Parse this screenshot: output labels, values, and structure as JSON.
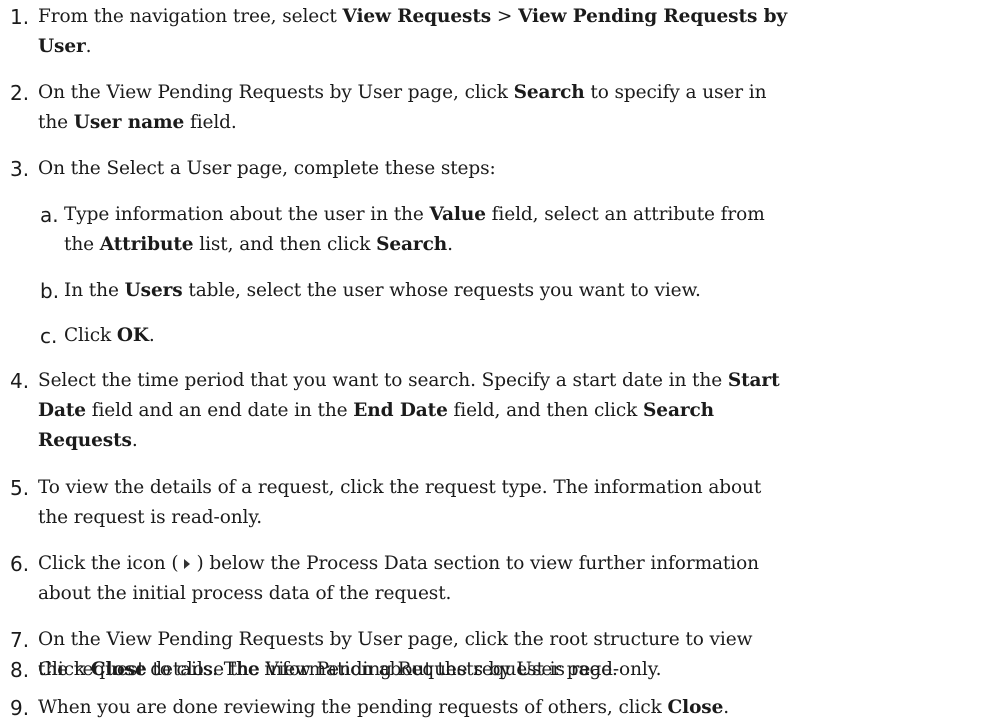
{
  "steps": {
    "s1": {
      "num": "1.",
      "t1": "From the navigation tree, select ",
      "b1": "View Requests",
      "t2": " > ",
      "b2": "View Pending Requests by",
      "b3": "User",
      "t3": "."
    },
    "s2": {
      "num": "2.",
      "t1": "On the View Pending Requests by User page, click ",
      "b1": "Search",
      "t2": " to specify a user in",
      "t3": "the ",
      "b2": "User name",
      "t4": " field."
    },
    "s3": {
      "num": "3.",
      "t1": "On the Select a User page, complete these steps:"
    },
    "s3a": {
      "num": "a.",
      "t1": "Type information about the user in the ",
      "b1": "Value",
      "t2": " field, select an attribute from",
      "t3": "the ",
      "b2": "Attribute",
      "t4": " list, and then click ",
      "b3": "Search",
      "t5": "."
    },
    "s3b": {
      "num": "b.",
      "t1": "In the ",
      "b1": "Users",
      "t2": " table, select the user whose requests you want to view."
    },
    "s3c": {
      "num": "c.",
      "t1": "Click ",
      "b1": "OK",
      "t2": "."
    },
    "s4": {
      "num": "4.",
      "t1": "Select the time period that you want to search. Specify a start date in the ",
      "b1": "Start",
      "b2": "Date",
      "t2": " field and an end date in the ",
      "b3": "End Date",
      "t3": " field, and then click ",
      "b4": "Search",
      "b5": "Requests",
      "t4": "."
    },
    "s5": {
      "num": "5.",
      "t1": "To view the details of a request, click the request type. The information about",
      "t2": "the request is read-only."
    },
    "s6": {
      "num": "6.",
      "t1": "Click the icon (",
      "t2": ") below the Process Data section to view further information",
      "t3": "about the initial process data of the request."
    },
    "s7": {
      "num": "7.",
      "t1": "On the View Pending Requests by User page, click the root structure to view",
      "t2": "the request details. The information about the request is read-only."
    },
    "s8": {
      "num": "8.",
      "t1": "Click ",
      "b1": "Close",
      "t2": " to close the View Pending Requests by User page."
    },
    "s9": {
      "num": "9.",
      "t1": "When you are done reviewing the pending requests of others, click ",
      "b1": "Close",
      "t2": "."
    }
  },
  "icons": {
    "expand": "expand-arrow-icon"
  }
}
